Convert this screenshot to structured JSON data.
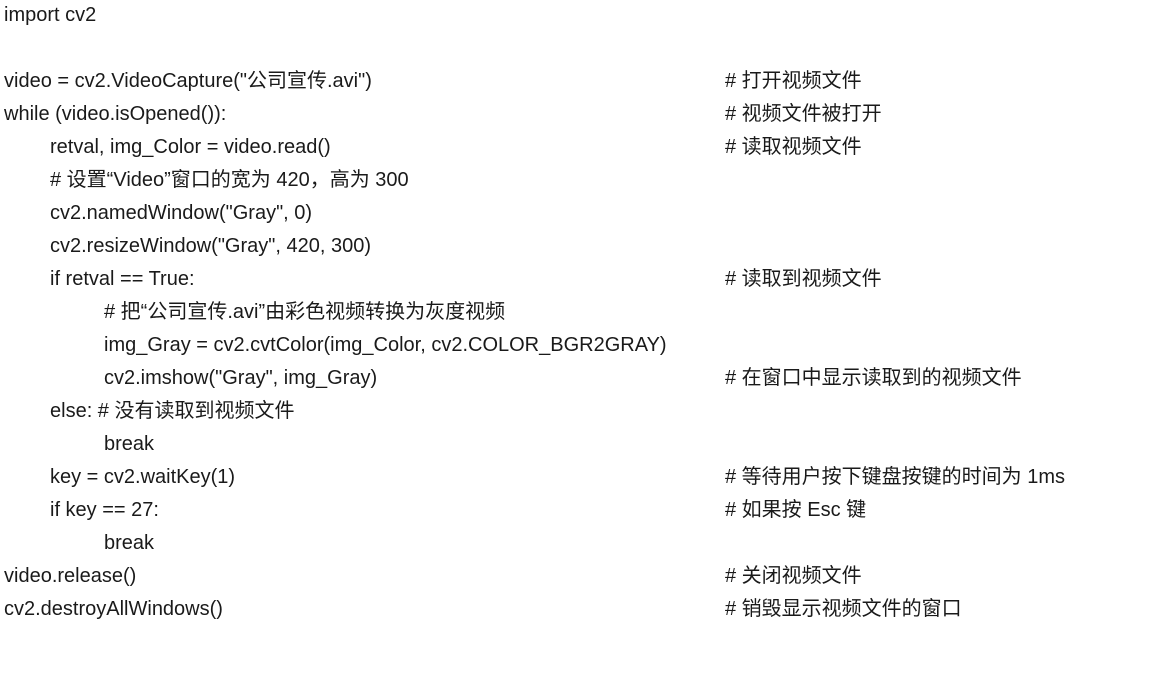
{
  "document": {
    "lines": [
      {
        "code": "import cv2",
        "comment": ""
      },
      {
        "code": "",
        "comment": ""
      },
      {
        "code": "video = cv2.VideoCapture(\"公司宣传.avi\")",
        "comment": "# 打开视频文件"
      },
      {
        "code": "while (video.isOpened()):",
        "comment": "# 视频文件被打开"
      },
      {
        "code": "retval, img_Color = video.read()",
        "comment": "# 读取视频文件"
      },
      {
        "code": "# 设置“Video”窗口的宽为 420，高为 300",
        "comment": ""
      },
      {
        "code": "cv2.namedWindow(\"Gray\", 0)",
        "comment": ""
      },
      {
        "code": "cv2.resizeWindow(\"Gray\", 420, 300)",
        "comment": ""
      },
      {
        "code": "if retval == True:",
        "comment": "# 读取到视频文件"
      },
      {
        "code": "# 把“公司宣传.avi”由彩色视频转换为灰度视频",
        "comment": ""
      },
      {
        "code": "img_Gray = cv2.cvtColor(img_Color, cv2.COLOR_BGR2GRAY)",
        "comment": ""
      },
      {
        "code": "cv2.imshow(\"Gray\", img_Gray)",
        "comment": "# 在窗口中显示读取到的视频文件"
      },
      {
        "code": "else: # 没有读取到视频文件",
        "comment": ""
      },
      {
        "code": "break",
        "comment": ""
      },
      {
        "code": "key = cv2.waitKey(1)",
        "comment": "# 等待用户按下键盘按键的时间为 1ms"
      },
      {
        "code": "if key == 27:",
        "comment": "# 如果按 Esc 键"
      },
      {
        "code": "break",
        "comment": ""
      },
      {
        "code": "video.release()",
        "comment": "# 关闭视频文件"
      },
      {
        "code": "cv2.destroyAllWindows()",
        "comment": "# 销毁显示视频文件的窗口"
      }
    ]
  }
}
